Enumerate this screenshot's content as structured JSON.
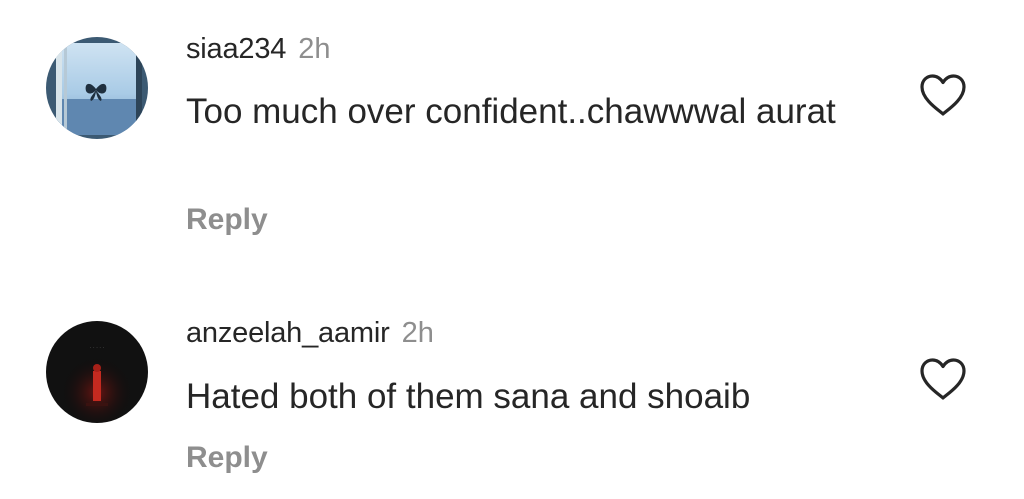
{
  "comments": [
    {
      "username": "siaa234",
      "time": "2h",
      "text": "Too much over confident..chawwwal aurat",
      "reply_label": "Reply",
      "avatar_icon": "butterfly-window-avatar",
      "like_icon": "heart-outline-icon"
    },
    {
      "username": "anzeelah_aamir",
      "time": "2h",
      "text": "Hated both of them sana and shoaib",
      "reply_label": "Reply",
      "avatar_icon": "dark-figure-avatar",
      "like_icon": "heart-outline-icon"
    }
  ],
  "colors": {
    "primary_text": "#262626",
    "secondary_text": "#8e8e8e",
    "background": "#ffffff"
  }
}
